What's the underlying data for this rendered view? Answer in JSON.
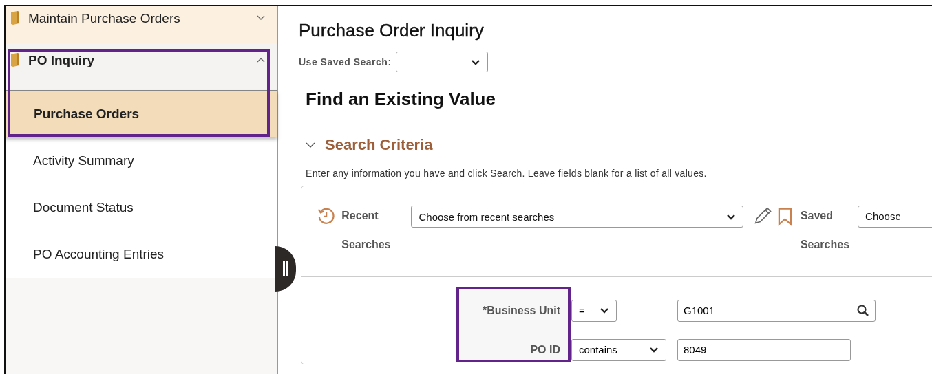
{
  "sidebar": {
    "items": [
      {
        "label": "Maintain Purchase Orders",
        "expanded": false
      },
      {
        "label": "PO Inquiry",
        "expanded": true,
        "highlighted": true,
        "children": [
          {
            "label": "Purchase Orders",
            "selected": true
          },
          {
            "label": "Activity Summary",
            "selected": false
          },
          {
            "label": "Document Status",
            "selected": false
          },
          {
            "label": "PO Accounting Entries",
            "selected": false
          }
        ]
      }
    ]
  },
  "page": {
    "title": "Purchase Order Inquiry",
    "saved_search_label": "Use Saved Search:",
    "heading": "Find an Existing Value"
  },
  "search_criteria": {
    "title": "Search Criteria",
    "expanded": true,
    "instructions": "Enter any information you have and click Search. Leave fields blank for a list of all values.",
    "recent_label": "Recent",
    "recent_label_2": "Searches",
    "recent_value": "Choose from recent searches",
    "saved_label": "Saved",
    "saved_label_2": "Searches",
    "saved_value": "Choose",
    "labels_highlighted": true,
    "fields": [
      {
        "label": "*Business Unit",
        "operator": "=",
        "value": "G1001",
        "kind": "lookup"
      },
      {
        "label": "PO ID",
        "operator": "contains",
        "value": "8049",
        "kind": "text"
      }
    ]
  }
}
